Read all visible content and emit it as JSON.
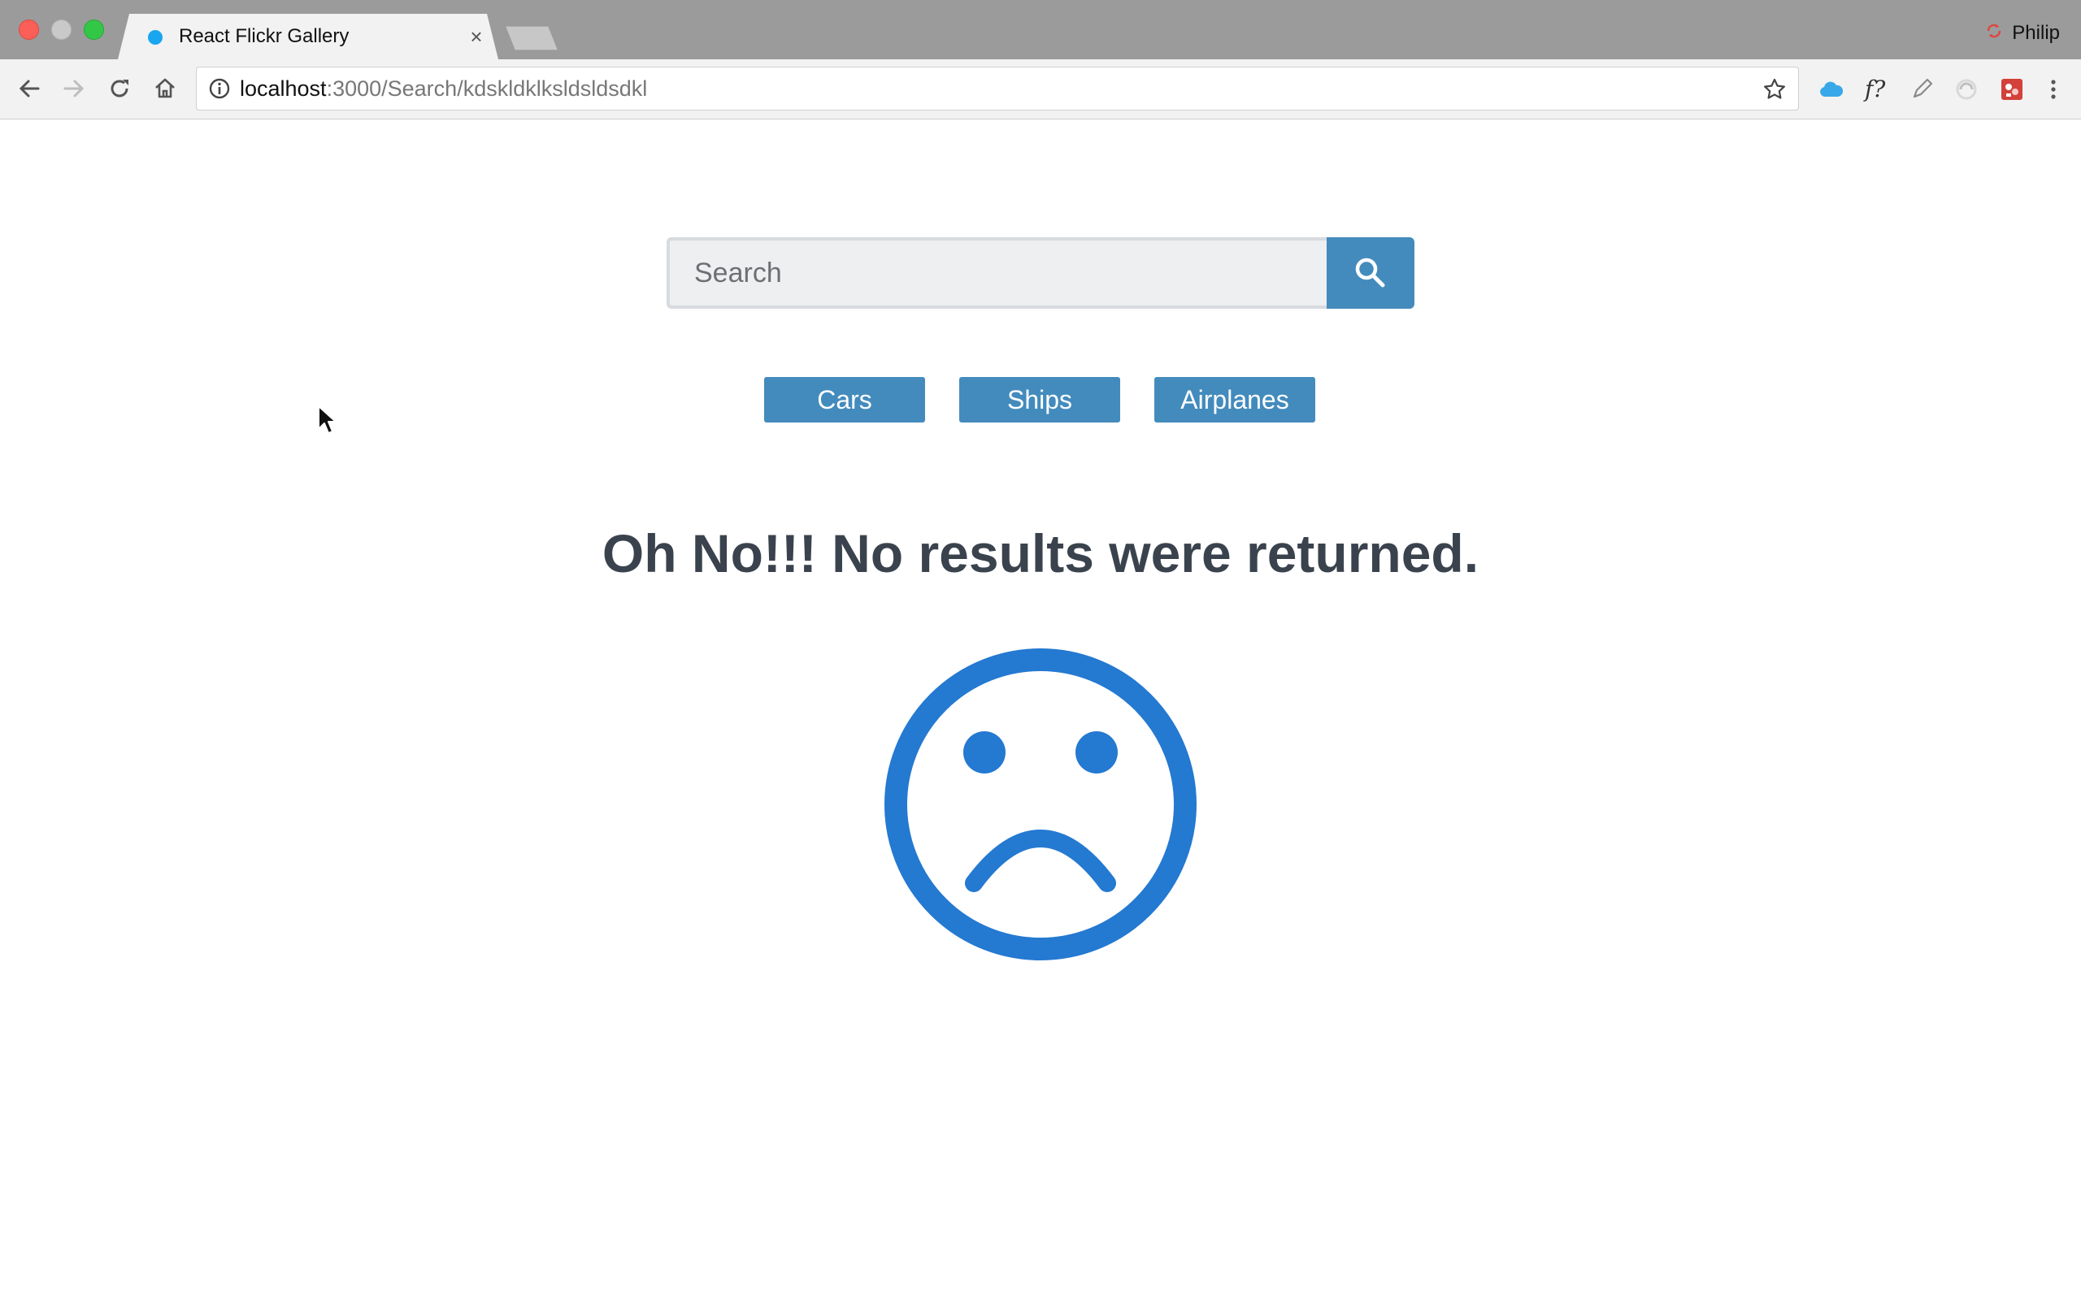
{
  "browser": {
    "tab_title": "React Flickr Gallery",
    "tab_close_glyph": "×",
    "profile_name": "Philip",
    "url_host": "localhost",
    "url_rest": ":3000/Search/kdskldklksldsldsdkl"
  },
  "search": {
    "placeholder": "Search",
    "value": ""
  },
  "nav": {
    "links": [
      {
        "label": "Cars"
      },
      {
        "label": "Ships"
      },
      {
        "label": "Airplanes"
      }
    ]
  },
  "results": {
    "heading": "Oh No!!! No results were returned."
  },
  "icons": {
    "search": "search-icon",
    "sad_face": "sad-face-icon",
    "extension_1": "cloud-icon",
    "extension_2": "font-question-icon",
    "extension_3": "pen-icon",
    "extension_4": "circle-swirl-icon",
    "extension_5": "red-app-icon"
  },
  "colors": {
    "accent": "#438bbd",
    "heading": "#3a434d",
    "sad_face": "#2479d1"
  }
}
